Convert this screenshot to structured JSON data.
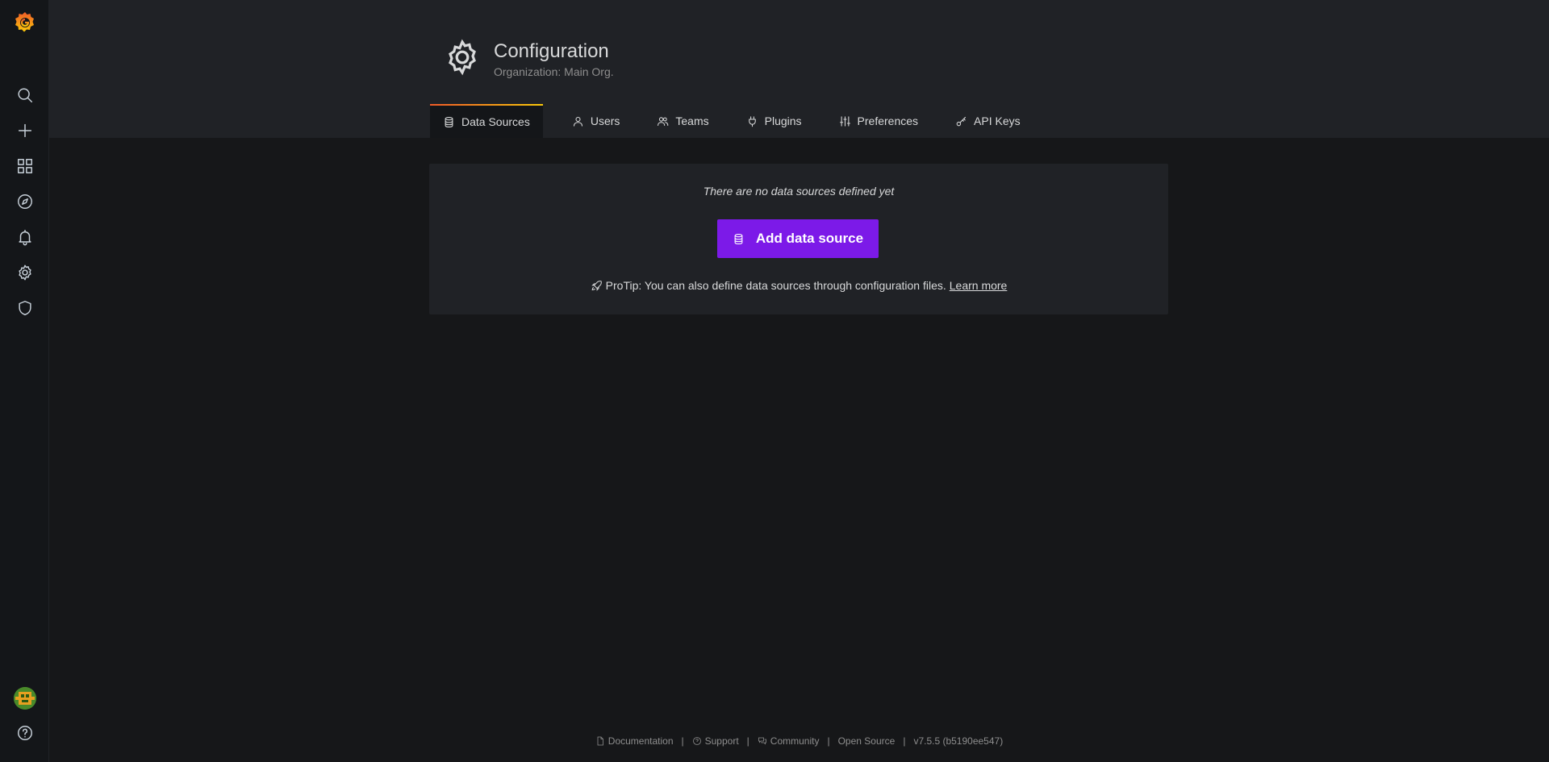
{
  "sidebar": {
    "items": [
      {
        "name": "search-icon"
      },
      {
        "name": "plus-icon"
      },
      {
        "name": "dashboards-icon"
      },
      {
        "name": "explore-icon"
      },
      {
        "name": "alerting-icon"
      },
      {
        "name": "gear-icon"
      },
      {
        "name": "shield-icon"
      }
    ],
    "help_icon": "question-circle-icon",
    "brand_color": "#f05a28"
  },
  "header": {
    "title": "Configuration",
    "subtitle": "Organization: Main Org."
  },
  "tabs": [
    {
      "label": "Data Sources",
      "icon": "database-icon",
      "active": true
    },
    {
      "label": "Users",
      "icon": "user-icon",
      "active": false
    },
    {
      "label": "Teams",
      "icon": "users-icon",
      "active": false
    },
    {
      "label": "Plugins",
      "icon": "plug-icon",
      "active": false
    },
    {
      "label": "Preferences",
      "icon": "sliders-icon",
      "active": false
    },
    {
      "label": "API Keys",
      "icon": "key-icon",
      "active": false
    }
  ],
  "empty_state": {
    "message": "There are no data sources defined yet",
    "button_label": "Add data source",
    "button_color": "#7c1ae8",
    "protip_text": "ProTip: You can also define data sources through configuration files.",
    "learn_more": "Learn more"
  },
  "footer": {
    "documentation": "Documentation",
    "support": "Support",
    "community": "Community",
    "open_source": "Open Source",
    "version": "v7.5.5 (b5190ee547)",
    "separator": "|"
  }
}
